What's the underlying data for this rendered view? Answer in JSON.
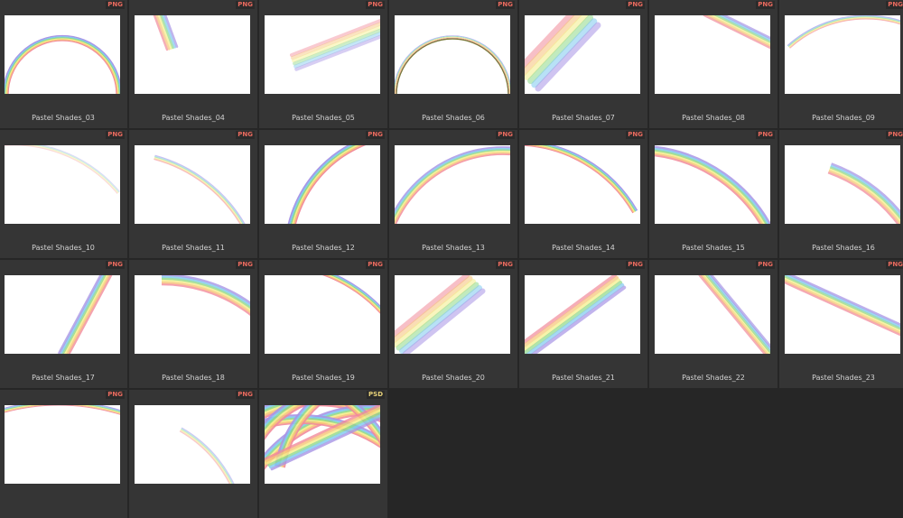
{
  "items": [
    {
      "name": "Pastel Shades_03",
      "type": "PNG"
    },
    {
      "name": "Pastel Shades_04",
      "type": "PNG"
    },
    {
      "name": "Pastel Shades_05",
      "type": "PNG"
    },
    {
      "name": "Pastel Shades_06",
      "type": "PNG"
    },
    {
      "name": "Pastel Shades_07",
      "type": "PNG"
    },
    {
      "name": "Pastel Shades_08",
      "type": "PNG"
    },
    {
      "name": "Pastel Shades_09",
      "type": "PNG"
    },
    {
      "name": "Pastel Shades_10",
      "type": "PNG"
    },
    {
      "name": "Pastel Shades_11",
      "type": "PNG"
    },
    {
      "name": "Pastel Shades_12",
      "type": "PNG"
    },
    {
      "name": "Pastel Shades_13",
      "type": "PNG"
    },
    {
      "name": "Pastel Shades_14",
      "type": "PNG"
    },
    {
      "name": "Pastel Shades_15",
      "type": "PNG"
    },
    {
      "name": "Pastel Shades_16",
      "type": "PNG"
    },
    {
      "name": "Pastel Shades_17",
      "type": "PNG"
    },
    {
      "name": "Pastel Shades_18",
      "type": "PNG"
    },
    {
      "name": "Pastel Shades_19",
      "type": "PNG"
    },
    {
      "name": "Pastel Shades_20",
      "type": "PNG"
    },
    {
      "name": "Pastel Shades_21",
      "type": "PNG"
    },
    {
      "name": "Pastel Shades_22",
      "type": "PNG"
    },
    {
      "name": "Pastel Shades_23",
      "type": "PNG"
    },
    {
      "name": "",
      "type": "PNG"
    },
    {
      "name": "",
      "type": "PNG"
    },
    {
      "name": "",
      "type": "PSD"
    }
  ],
  "colors": {
    "background": "#262626",
    "cell": "#353535",
    "png_badge": "#e86a5e",
    "psd_badge": "#e8d27a"
  }
}
